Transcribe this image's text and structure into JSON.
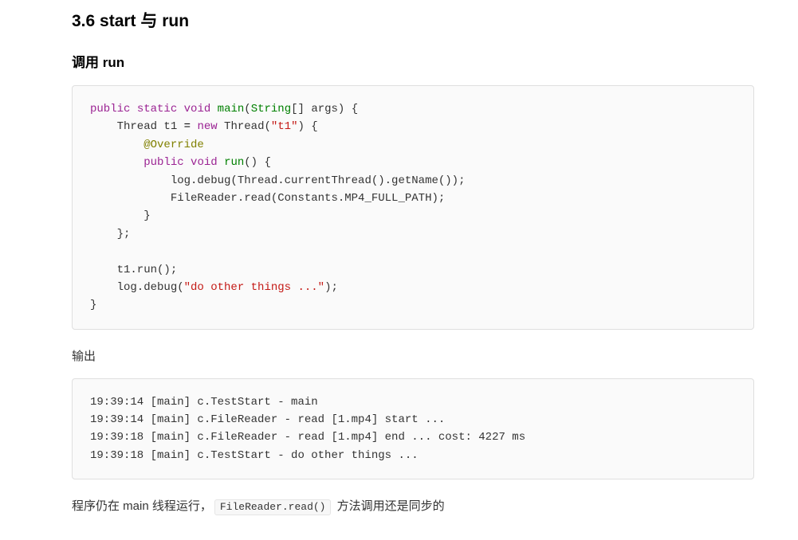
{
  "section": {
    "title": "3.6 start 与 run",
    "subtitle": "调用 run"
  },
  "code1": {
    "tokens": [
      {
        "t": "public",
        "c": "kw"
      },
      {
        "t": " "
      },
      {
        "t": "static",
        "c": "kw"
      },
      {
        "t": " "
      },
      {
        "t": "void",
        "c": "kw"
      },
      {
        "t": " "
      },
      {
        "t": "main",
        "c": "type"
      },
      {
        "t": "("
      },
      {
        "t": "String",
        "c": "type"
      },
      {
        "t": "[] args) {\n"
      },
      {
        "t": "    Thread t1 "
      },
      {
        "t": "=",
        "c": "op"
      },
      {
        "t": " "
      },
      {
        "t": "new",
        "c": "kw"
      },
      {
        "t": " Thread("
      },
      {
        "t": "\"t1\"",
        "c": "str"
      },
      {
        "t": ") {\n"
      },
      {
        "t": "        "
      },
      {
        "t": "@Override",
        "c": "ann"
      },
      {
        "t": "\n"
      },
      {
        "t": "        "
      },
      {
        "t": "public",
        "c": "kw"
      },
      {
        "t": " "
      },
      {
        "t": "void",
        "c": "kw"
      },
      {
        "t": " "
      },
      {
        "t": "run",
        "c": "type"
      },
      {
        "t": "() {\n"
      },
      {
        "t": "            log.debug(Thread.currentThread().getName());\n"
      },
      {
        "t": "            FileReader.read(Constants.MP4_FULL_PATH);\n"
      },
      {
        "t": "        }\n"
      },
      {
        "t": "    };\n"
      },
      {
        "t": "\n"
      },
      {
        "t": "    t1.run();\n"
      },
      {
        "t": "    log.debug("
      },
      {
        "t": "\"do other things ...\"",
        "c": "str"
      },
      {
        "t": ");\n"
      },
      {
        "t": "}"
      }
    ]
  },
  "output_label": "输出",
  "code2": {
    "text": "19:39:14 [main] c.TestStart - main\n19:39:14 [main] c.FileReader - read [1.mp4] start ...\n19:39:18 [main] c.FileReader - read [1.mp4] end ... cost: 4227 ms\n19:39:18 [main] c.TestStart - do other things ..."
  },
  "description": {
    "part1": "程序仍在 main 线程运行，",
    "inline_code": "FileReader.read()",
    "part2": " 方法调用还是同步的"
  }
}
